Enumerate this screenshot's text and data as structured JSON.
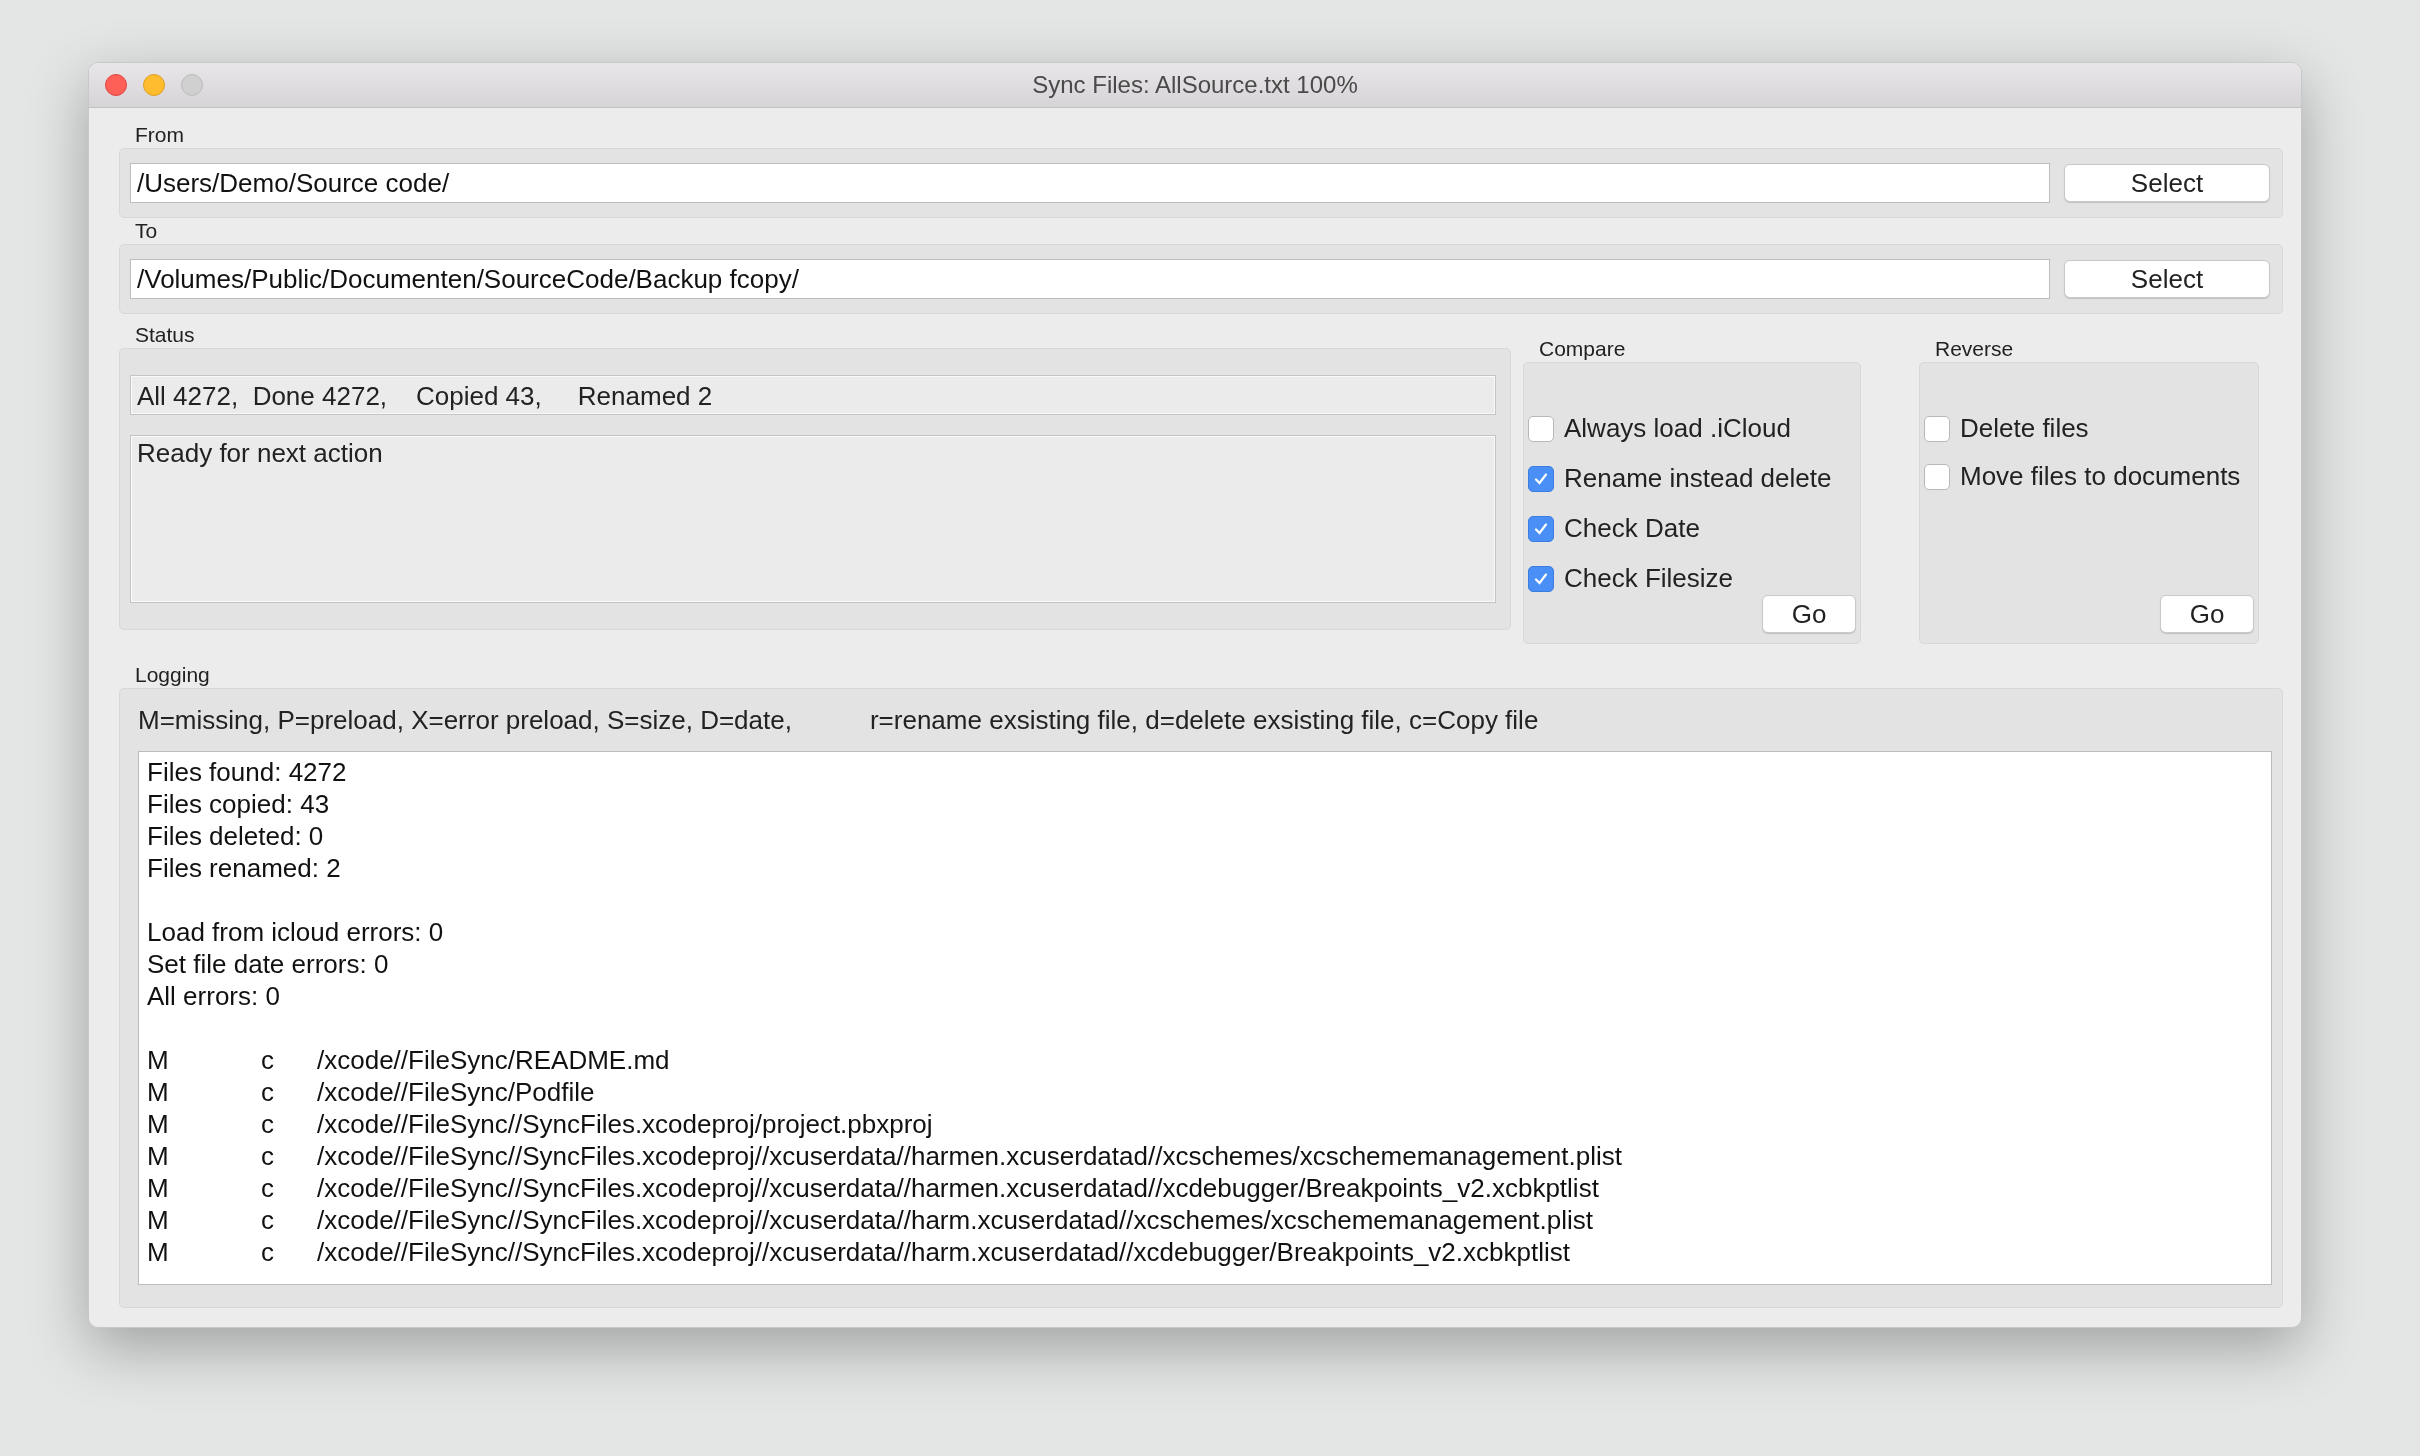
{
  "window": {
    "title": "Sync Files: AllSource.txt 100%"
  },
  "from": {
    "label": "From",
    "value": "/Users/Demo/Source code/",
    "button": "Select"
  },
  "to": {
    "label": "To",
    "value": "/Volumes/Public/Documenten/SourceCode/Backup fcopy/",
    "button": "Select"
  },
  "status": {
    "label": "Status",
    "counts": "All 4272,  Done 4272,    Copied 43,     Renamed 2",
    "message": "Ready for next action"
  },
  "compare": {
    "label": "Compare",
    "options": [
      {
        "label": "Always load .iCloud",
        "checked": false
      },
      {
        "label": "Rename instead delete",
        "checked": true
      },
      {
        "label": "Check Date",
        "checked": true
      },
      {
        "label": "Check Filesize",
        "checked": true
      }
    ],
    "button": "Go"
  },
  "reverse": {
    "label": "Reverse",
    "options": [
      {
        "label": "Delete files",
        "checked": false
      },
      {
        "label": "Move files to documents",
        "checked": false
      }
    ],
    "button": "Go"
  },
  "logging": {
    "label": "Logging",
    "legend": [
      "M=missing, P=preload, X=error preload, S=size, D=date,",
      "r=rename exsisting file, d=delete exsisting file, c=Copy file"
    ],
    "summary": [
      "Files found: 4272",
      "Files copied: 43",
      "Files deleted: 0",
      "Files renamed: 2"
    ],
    "errors": [
      "Load from icloud errors: 0",
      "Set file date errors: 0",
      "All errors: 0"
    ],
    "entries": [
      {
        "flag": "M",
        "action": "c",
        "path": "/xcode//FileSync/README.md"
      },
      {
        "flag": "M",
        "action": "c",
        "path": "/xcode//FileSync/Podfile"
      },
      {
        "flag": "M",
        "action": "c",
        "path": "/xcode//FileSync//SyncFiles.xcodeproj/project.pbxproj"
      },
      {
        "flag": "M",
        "action": "c",
        "path": "/xcode//FileSync//SyncFiles.xcodeproj//xcuserdata//harmen.xcuserdatad//xcschemes/xcschememanagement.plist"
      },
      {
        "flag": "M",
        "action": "c",
        "path": "/xcode//FileSync//SyncFiles.xcodeproj//xcuserdata//harmen.xcuserdatad//xcdebugger/Breakpoints_v2.xcbkptlist"
      },
      {
        "flag": "M",
        "action": "c",
        "path": "/xcode//FileSync//SyncFiles.xcodeproj//xcuserdata//harm.xcuserdatad//xcschemes/xcschememanagement.plist"
      },
      {
        "flag": "M",
        "action": "c",
        "path": "/xcode//FileSync//SyncFiles.xcodeproj//xcuserdata//harm.xcuserdatad//xcdebugger/Breakpoints_v2.xcbkptlist"
      }
    ]
  }
}
